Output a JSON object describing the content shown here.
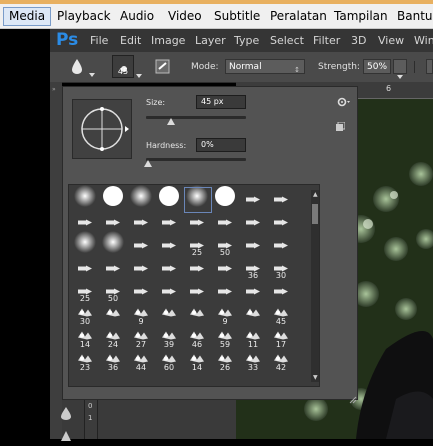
{
  "vlc_menu": [
    "Media",
    "Playback",
    "Audio",
    "Video",
    "Subtitle",
    "Peralatan",
    "Tampilan",
    "Bantuan"
  ],
  "ps_menu": [
    "File",
    "Edit",
    "Image",
    "Layer",
    "Type",
    "Select",
    "Filter",
    "3D",
    "View",
    "Win"
  ],
  "ps_logo": "Ps",
  "options_bar": {
    "brush_size": "45",
    "mode_label": "Mode:",
    "mode_value": "Normal",
    "strength_label": "Strength:",
    "strength_value": "50%"
  },
  "brush_panel": {
    "size_label": "Size:",
    "size_value": "45 px",
    "hardness_label": "Hardness:",
    "hardness_value": "0%",
    "size_level": 0.25,
    "hardness_level": 0.02
  },
  "ruler_number": "6",
  "vertical_ruler": [
    "0",
    "1"
  ],
  "preset_rows": [
    [
      "",
      "",
      "",
      "",
      "",
      "",
      "",
      ""
    ],
    [
      "",
      "",
      "",
      "",
      "",
      "",
      "",
      ""
    ],
    [
      "",
      "",
      "",
      "",
      "25",
      "50",
      "",
      ""
    ],
    [
      "",
      "",
      "",
      "",
      "",
      "",
      "36",
      "30"
    ],
    [
      "25",
      "50",
      "",
      "",
      "",
      "",
      "",
      ""
    ],
    [
      "30",
      "",
      "9",
      "",
      "",
      "9",
      "",
      "45"
    ],
    [
      "14",
      "24",
      "27",
      "39",
      "46",
      "59",
      "11",
      "17"
    ],
    [
      "23",
      "36",
      "44",
      "60",
      "14",
      "26",
      "33",
      "42"
    ]
  ],
  "colors": {
    "ps_blue": "#2b8ce6",
    "panel": "#535353",
    "accent_orange": "#e8b060"
  }
}
